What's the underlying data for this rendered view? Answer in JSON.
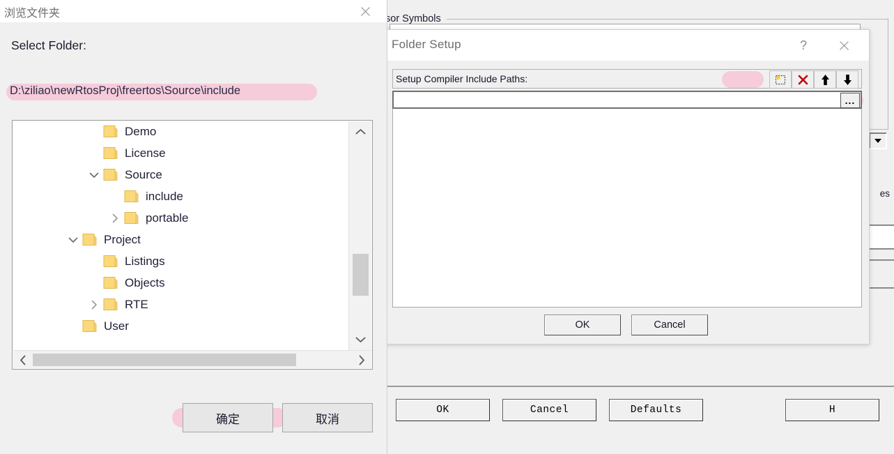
{
  "background_window": {
    "group_label": "sor Symbols",
    "text_fragment_right": "es",
    "buttons": [
      {
        "label": "OK",
        "name": "ok"
      },
      {
        "label": "Cancel",
        "name": "cancel"
      },
      {
        "label": "Defaults",
        "name": "defaults"
      },
      {
        "label": "H",
        "name": "help"
      }
    ]
  },
  "folder_setup": {
    "title": "Folder Setup",
    "help_glyph": "?",
    "toolbar": {
      "label": "Setup Compiler Include Paths:",
      "buttons": [
        {
          "name": "new-path-icon",
          "glyph": "new"
        },
        {
          "name": "delete-path-icon",
          "glyph": "x"
        },
        {
          "name": "move-up-icon",
          "glyph": "up"
        },
        {
          "name": "move-down-icon",
          "glyph": "down"
        }
      ]
    },
    "path_input": {
      "value": "",
      "placeholder": "",
      "browse_label": "..."
    },
    "ok_label": "OK",
    "cancel_label": "Cancel"
  },
  "browse_dialog": {
    "title": "浏览文件夹",
    "select_label": "Select Folder:",
    "path": "D:\\ziliao\\newRtosProj\\freertos\\Source\\include",
    "tree": [
      {
        "label": "Demo",
        "indent": 3,
        "expander": "none"
      },
      {
        "label": "License",
        "indent": 3,
        "expander": "none"
      },
      {
        "label": "Source",
        "indent": 3,
        "expander": "open"
      },
      {
        "label": "include",
        "indent": 4,
        "expander": "none"
      },
      {
        "label": "portable",
        "indent": 4,
        "expander": "closed"
      },
      {
        "label": "Project",
        "indent": 2,
        "expander": "open"
      },
      {
        "label": "Listings",
        "indent": 3,
        "expander": "none"
      },
      {
        "label": "Objects",
        "indent": 3,
        "expander": "none"
      },
      {
        "label": "RTE",
        "indent": 3,
        "expander": "closed"
      },
      {
        "label": "User",
        "indent": 2,
        "expander": "none"
      }
    ],
    "ok_label": "确定",
    "cancel_label": "取消"
  },
  "colors": {
    "highlight_pink": "#f7c9d8",
    "folder_yellow": "#fbd97a",
    "dialog_bg": "#f0f0f0",
    "accent_red": "#c00000"
  }
}
